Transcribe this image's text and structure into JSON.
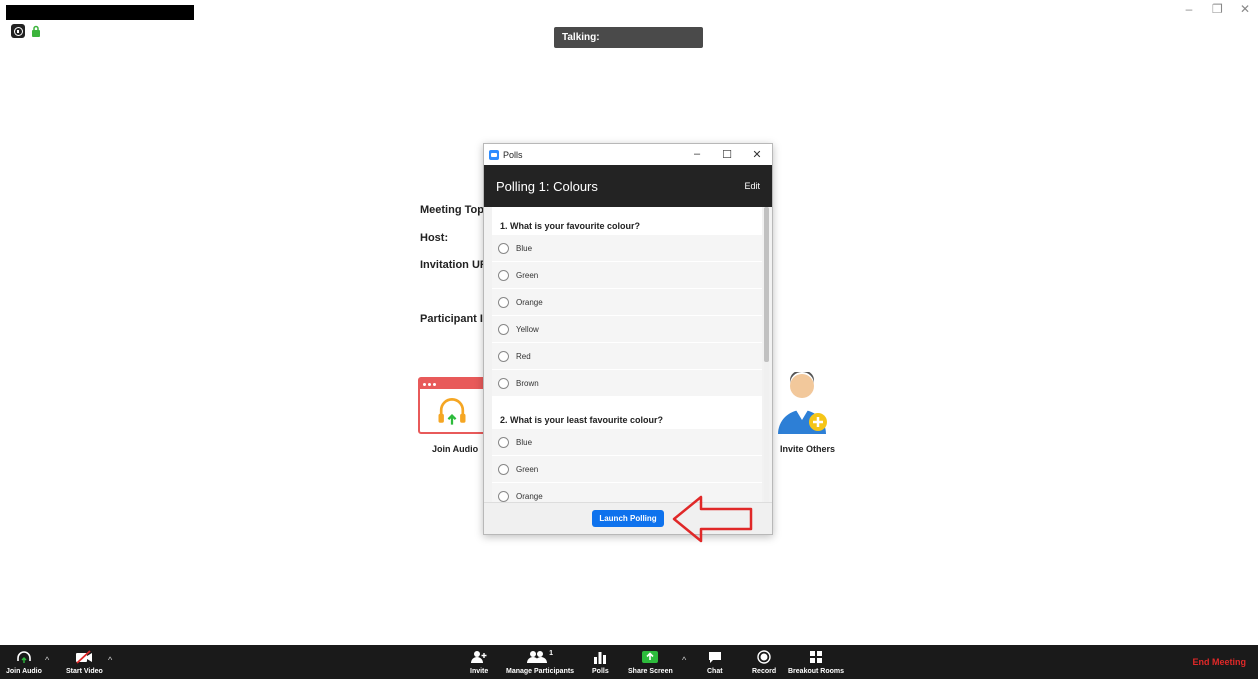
{
  "window": {
    "minimize_glyph": "–",
    "restore_glyph": "❐",
    "close_glyph": "✕"
  },
  "talking_indicator": "Talking:",
  "meeting_info": {
    "topic_label": "Meeting Topic",
    "host_label": "Host:",
    "invitation_label": "Invitation URL",
    "participant_label": "Participant ID"
  },
  "tiles": {
    "join_audio": "Join Audio",
    "invite_others": "Invite Others"
  },
  "polls": {
    "window_title": "Polls",
    "header_title": "Polling 1: Colours",
    "edit_label": "Edit",
    "questions": [
      {
        "title": "1. What is your favourite colour?",
        "options": [
          "Blue",
          "Green",
          "Orange",
          "Yellow",
          "Red",
          "Brown"
        ]
      },
      {
        "title": "2. What is your least favourite colour?",
        "options": [
          "Blue",
          "Green",
          "Orange"
        ]
      }
    ],
    "launch_label": "Launch Polling"
  },
  "toolbar": {
    "join_audio": "Join Audio",
    "start_video": "Start Video",
    "invite": "Invite",
    "manage_participants": "Manage Participants",
    "participant_count": "1",
    "polls": "Polls",
    "share_screen": "Share Screen",
    "chat": "Chat",
    "record": "Record",
    "breakout_rooms": "Breakout Rooms",
    "end_meeting": "End Meeting"
  },
  "colors": {
    "accent_blue": "#0e72ed",
    "end_red": "#e02828",
    "share_green": "#2dbb3c",
    "audio_red": "#e85a5a"
  }
}
